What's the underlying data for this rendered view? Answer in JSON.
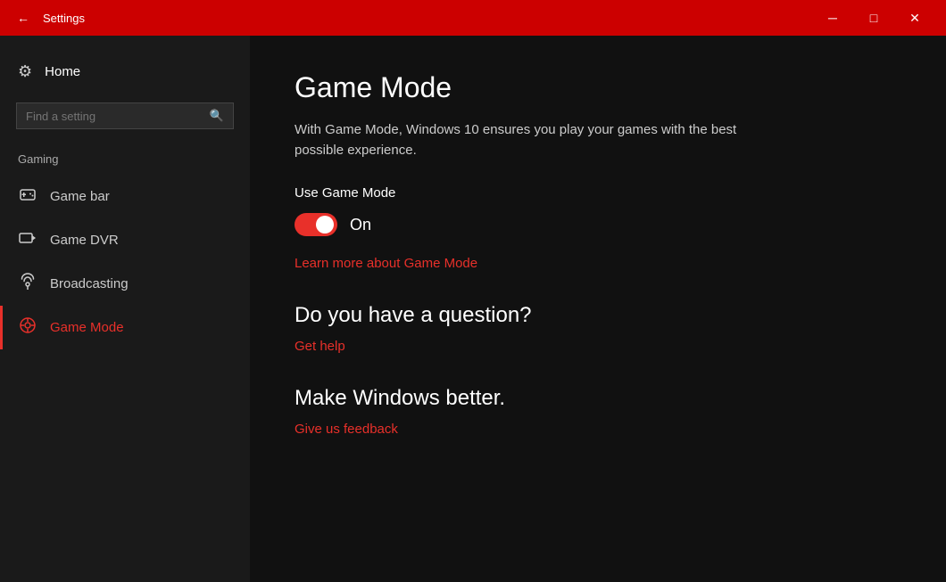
{
  "titlebar": {
    "title": "Settings",
    "back_icon": "←",
    "minimize_icon": "─",
    "maximize_icon": "□",
    "close_icon": "✕"
  },
  "sidebar": {
    "home_label": "Home",
    "search_placeholder": "Find a setting",
    "section_label": "Gaming",
    "items": [
      {
        "id": "game-bar",
        "label": "Game bar",
        "icon": "▣"
      },
      {
        "id": "game-dvr",
        "label": "Game DVR",
        "icon": "◫"
      },
      {
        "id": "broadcasting",
        "label": "Broadcasting",
        "icon": "◎"
      },
      {
        "id": "game-mode",
        "label": "Game Mode",
        "icon": "◎",
        "active": true
      }
    ]
  },
  "main": {
    "title": "Game Mode",
    "description": "With Game Mode, Windows 10 ensures you play your games with the best possible experience.",
    "use_game_mode_label": "Use Game Mode",
    "toggle_state": "On",
    "toggle_on": true,
    "learn_more_link": "Learn more about Game Mode",
    "question_heading": "Do you have a question?",
    "get_help_link": "Get help",
    "make_better_heading": "Make Windows better.",
    "feedback_link": "Give us feedback"
  }
}
